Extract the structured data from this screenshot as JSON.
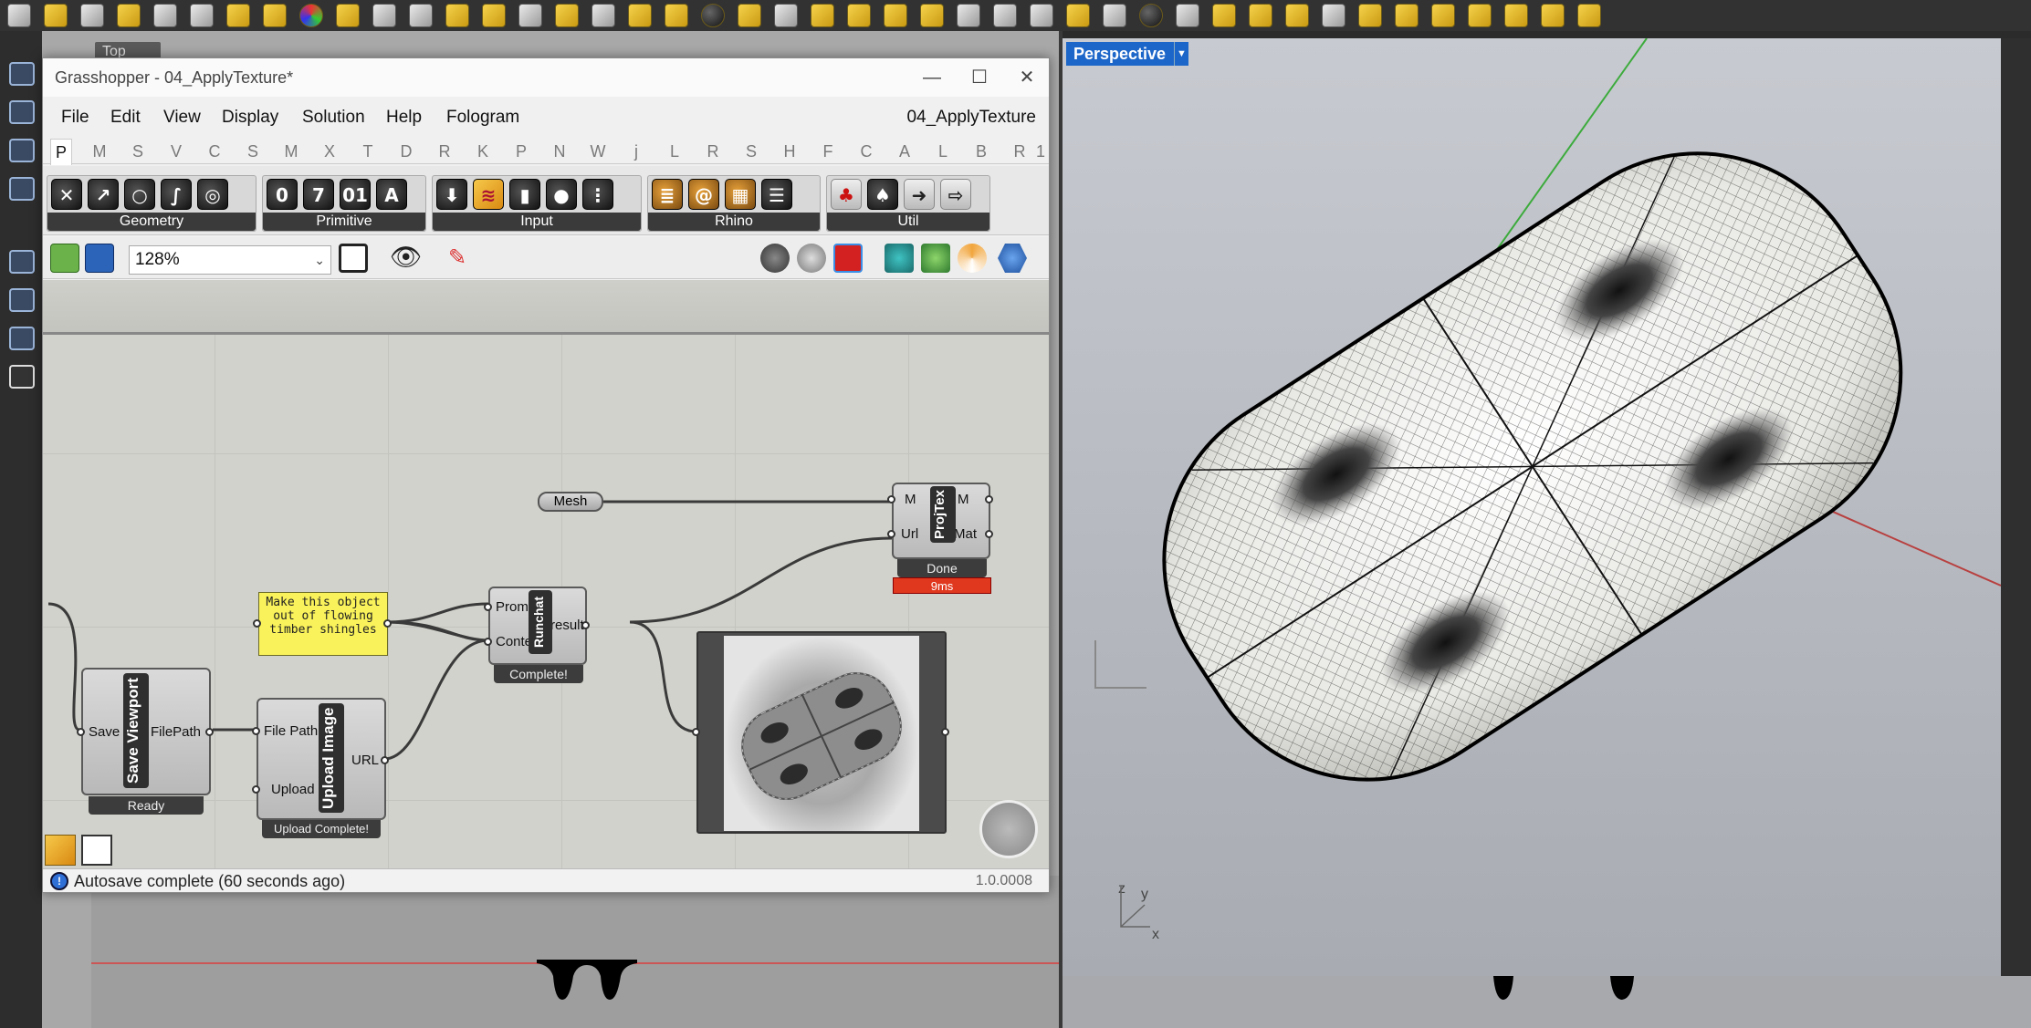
{
  "rhino": {
    "left_viewport_tab": "Top",
    "perspective_viewport_tab": "Perspective"
  },
  "grasshopper": {
    "window_title": "Grasshopper - 04_ApplyTexture*",
    "document_name": "04_ApplyTexture",
    "menu": [
      "File",
      "Edit",
      "View",
      "Display",
      "Solution",
      "Help",
      "Fologram"
    ],
    "tabs": [
      "P",
      "M",
      "S",
      "V",
      "C",
      "S",
      "M",
      "X",
      "T",
      "D",
      "R",
      "K",
      "P",
      "N",
      "W",
      "j",
      "L",
      "R",
      "S",
      "H",
      "F",
      "C",
      "A",
      "L",
      "B",
      "R",
      "1"
    ],
    "active_tab": "P",
    "ribbon_groups": [
      {
        "label": "Geometry"
      },
      {
        "label": "Primitive",
        "icons": [
          "0",
          "7",
          "01",
          "A"
        ]
      },
      {
        "label": "Input"
      },
      {
        "label": "Rhino"
      },
      {
        "label": "Util"
      }
    ],
    "zoom": "128%",
    "components": {
      "mesh_param": {
        "label": "Mesh"
      },
      "note_panel": {
        "text": "Make this object out of flowing timber shingles"
      },
      "runchat": {
        "name": "Runchat",
        "inputs": [
          "Prompt",
          "Context"
        ],
        "outputs": [
          "result"
        ],
        "status": "Complete!"
      },
      "projtex": {
        "name": "ProjTex",
        "inputs": [
          "M",
          "Url"
        ],
        "outputs": [
          "M",
          "Mat"
        ],
        "status": "Done",
        "timing": "9ms"
      },
      "save_viewport": {
        "name": "Save Viewport",
        "inputs": [
          "Save"
        ],
        "outputs": [
          "FilePath"
        ],
        "status": "Ready"
      },
      "upload_image": {
        "name": "Upload Image",
        "inputs": [
          "File Path",
          "Upload"
        ],
        "outputs": [
          "URL"
        ],
        "status": "Upload Complete!"
      }
    },
    "status_bar": {
      "message": "Autosave complete (60 seconds ago)",
      "version": "1.0.0008"
    }
  },
  "axis_labels": {
    "z": "z",
    "y": "y",
    "x": "x"
  }
}
